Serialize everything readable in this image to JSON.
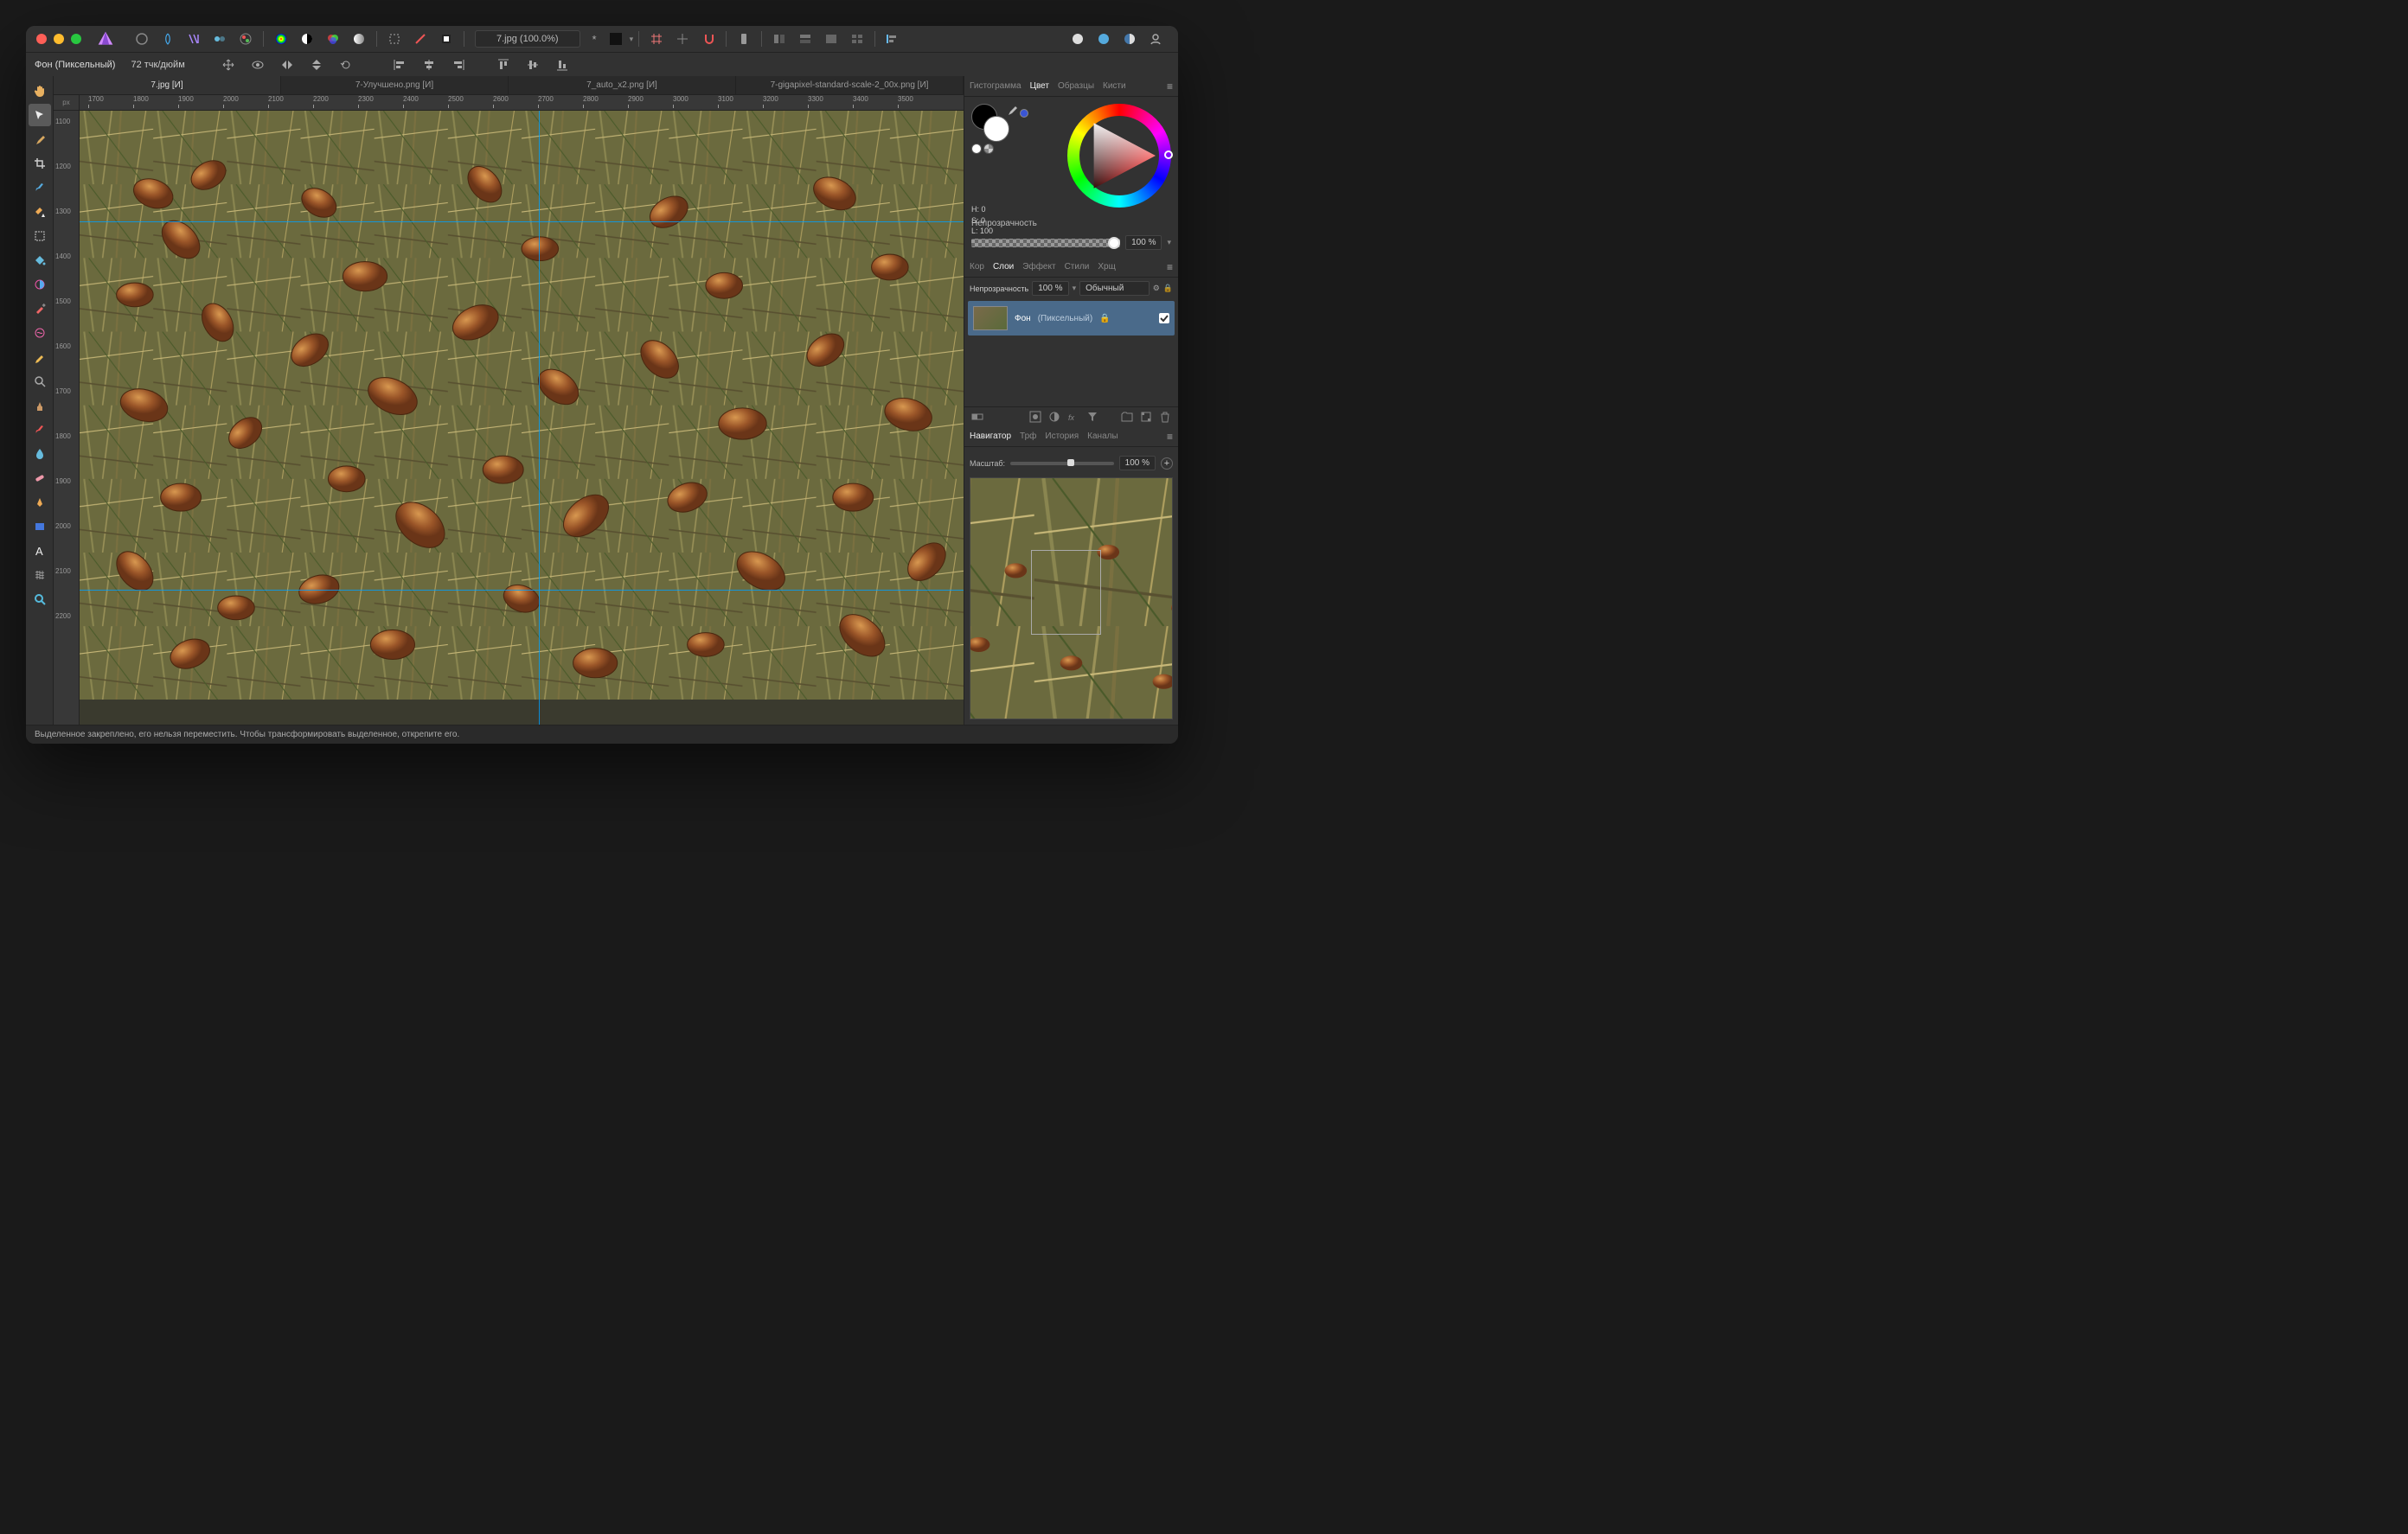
{
  "title_field": "7.jpg (100.0%)",
  "context": {
    "layer_label": "Фон (Пиксельный)",
    "dpi": "72 тчк/дюйм"
  },
  "doc_tabs": [
    "7.jpg [И]",
    "7-Улучшено.png [И]",
    "7_auto_x2.png [И]",
    "7-gigapixel-standard-scale-2_00x.png [И]"
  ],
  "ruler_unit": "px",
  "ruler_h": [
    "1700",
    "1800",
    "1900",
    "2000",
    "2100",
    "2200",
    "2300",
    "2400",
    "2500",
    "2600",
    "2700",
    "2800",
    "2900",
    "3000",
    "3100",
    "3200",
    "3300",
    "3400",
    "3500"
  ],
  "ruler_v": [
    "1100",
    "1200",
    "1300",
    "1400",
    "1500",
    "1600",
    "1700",
    "1800",
    "1900",
    "2000",
    "2100",
    "2200"
  ],
  "color_tabs": [
    "Гистограмма",
    "Цвет",
    "Образцы",
    "Кисти"
  ],
  "color_tabs_active": 1,
  "hsl": {
    "h": "H: 0",
    "s": "S: 0",
    "l": "L: 100"
  },
  "opacity_label": "Непрозрачность",
  "opacity_value": "100 %",
  "layer_tabs": [
    "Кор",
    "Слои",
    "Эффект",
    "Стили",
    "Хрщ"
  ],
  "layer_tabs_active": 1,
  "layer_opacity_label": "Непрозрачность",
  "layer_opacity_val": "100 %",
  "blend_mode": "Обычный",
  "layer": {
    "name": "Фон",
    "type": "(Пиксельный)"
  },
  "nav_tabs": [
    "Навигатор",
    "Трф",
    "История",
    "Каналы"
  ],
  "nav_tabs_active": 0,
  "zoom_label": "Масштаб:",
  "zoom_value": "100 %",
  "status": "Выделенное закреплено, его нельзя переместить. Чтобы трансформировать выделенное, открепите его.",
  "tools": [
    "hand",
    "pointer",
    "eyedropper",
    "crop",
    "brush",
    "fx",
    "marquee",
    "flood",
    "mixer",
    "paint",
    "paint-mix",
    "pencil",
    "zoom-in",
    "stamp",
    "heal",
    "drop",
    "band-aid",
    "pen",
    "rect",
    "text",
    "mesh",
    "search"
  ]
}
